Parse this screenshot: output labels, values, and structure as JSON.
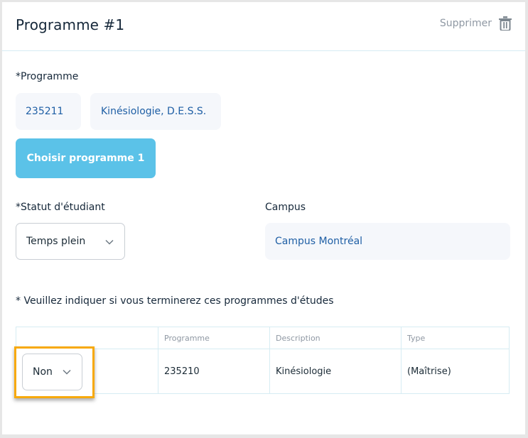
{
  "header": {
    "title": "Programme #1",
    "delete_label": "Supprimer",
    "delete_icon": "trash-icon"
  },
  "programme": {
    "label": "*Programme",
    "code": "235211",
    "name": "Kinésiologie, D.E.S.S.",
    "choose_button": "Choisir programme 1"
  },
  "statut": {
    "label": "*Statut d'étudiant",
    "value": "Temps plein",
    "icon": "chevron-down-icon"
  },
  "campus": {
    "label": "Campus",
    "value": "Campus Montréal"
  },
  "completion": {
    "prompt": "* Veuillez indiquer si vous terminerez ces programmes d'études",
    "table": {
      "headers": [
        "",
        "Programme",
        "Description",
        "Type"
      ],
      "rows": [
        {
          "selection": "Non",
          "programme": "235210",
          "description": "Kinésiologie",
          "type": "(Maîtrise)"
        }
      ]
    }
  },
  "colors": {
    "accent": "#5bc2e8",
    "link_text": "#1f5fa5",
    "highlight": "#f7a90c"
  }
}
